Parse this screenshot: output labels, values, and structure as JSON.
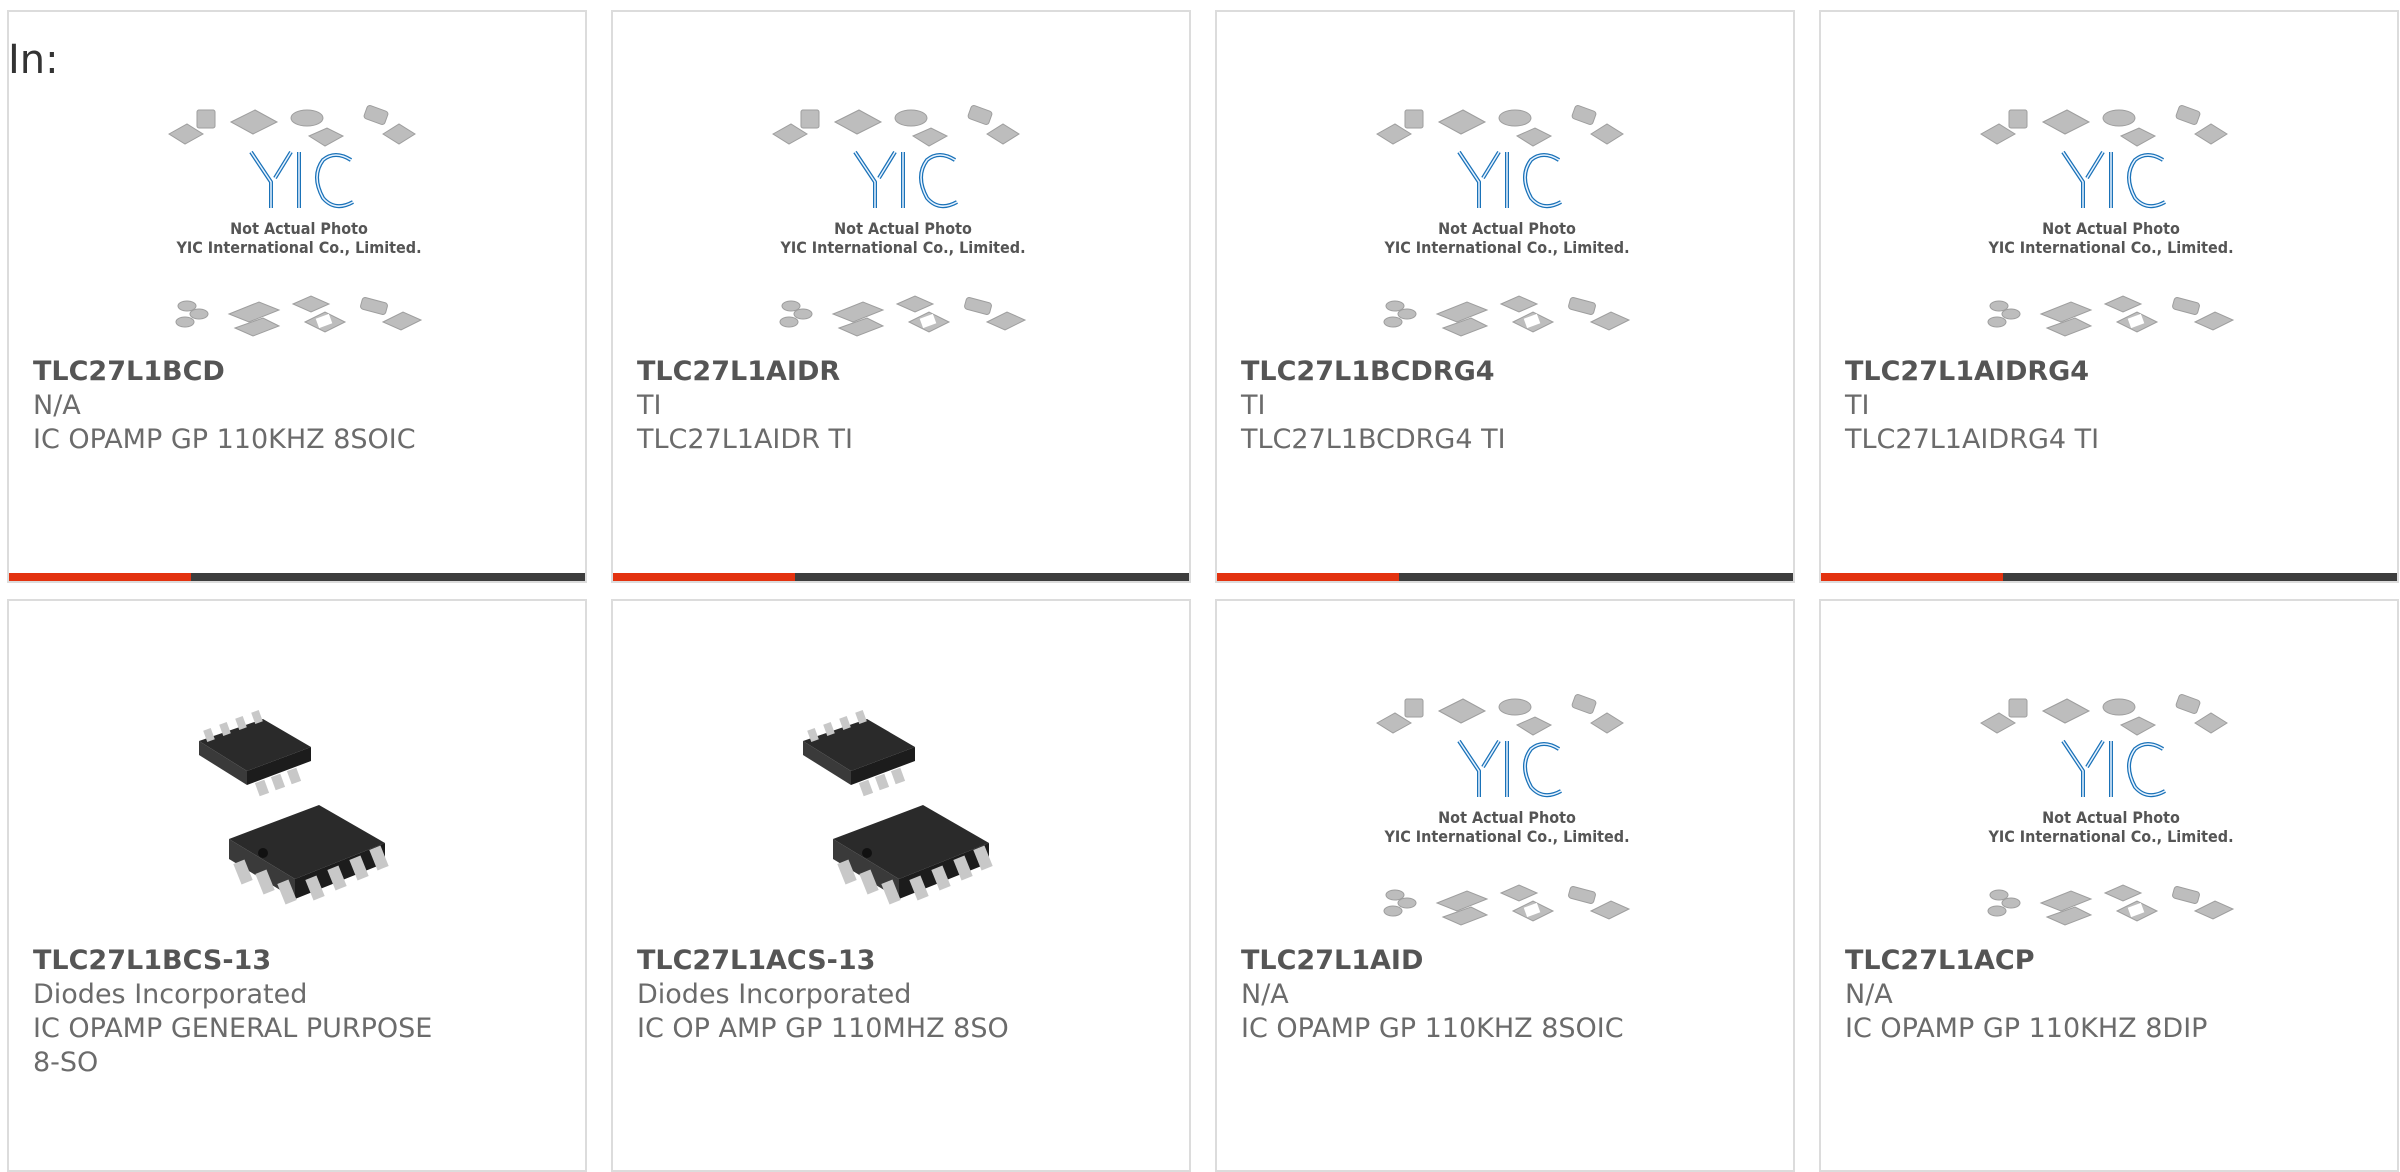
{
  "header": {
    "label": "In:"
  },
  "placeholder": {
    "line1": "Not Actual Photo",
    "line2": "YIC International Co., Limited.",
    "logo": "YIC"
  },
  "colors": {
    "accent": "#e3320f",
    "bar": "#3d3d3d",
    "border": "#dcdcdc",
    "logo": "#1a72b8"
  },
  "products": [
    {
      "part": "TLC27L1BCD",
      "maker": "N/A",
      "desc": "IC OPAMP GP 110KHZ 8SOIC",
      "image": "placeholder",
      "bar": true
    },
    {
      "part": "TLC27L1AIDR",
      "maker": "TI",
      "desc": "TLC27L1AIDR TI",
      "image": "placeholder",
      "bar": true
    },
    {
      "part": "TLC27L1BCDRG4",
      "maker": "TI",
      "desc": "TLC27L1BCDRG4 TI",
      "image": "placeholder",
      "bar": true
    },
    {
      "part": "TLC27L1AIDRG4",
      "maker": "TI",
      "desc": "TLC27L1AIDRG4 TI",
      "image": "placeholder",
      "bar": true
    },
    {
      "part": "TLC27L1BCS-13",
      "maker": "Diodes Incorporated",
      "desc": "IC OPAMP GENERAL PURPOSE 8-SO",
      "image": "so8-chip",
      "bar": false
    },
    {
      "part": "TLC27L1ACS-13",
      "maker": "Diodes Incorporated",
      "desc": "IC OP AMP GP 110MHZ 8SO",
      "image": "so8-chip",
      "bar": false
    },
    {
      "part": "TLC27L1AID",
      "maker": "N/A",
      "desc": "IC OPAMP GP 110KHZ 8SOIC",
      "image": "placeholder",
      "bar": false
    },
    {
      "part": "TLC27L1ACP",
      "maker": "N/A",
      "desc": "IC OPAMP GP 110KHZ 8DIP",
      "image": "placeholder",
      "bar": false
    }
  ]
}
